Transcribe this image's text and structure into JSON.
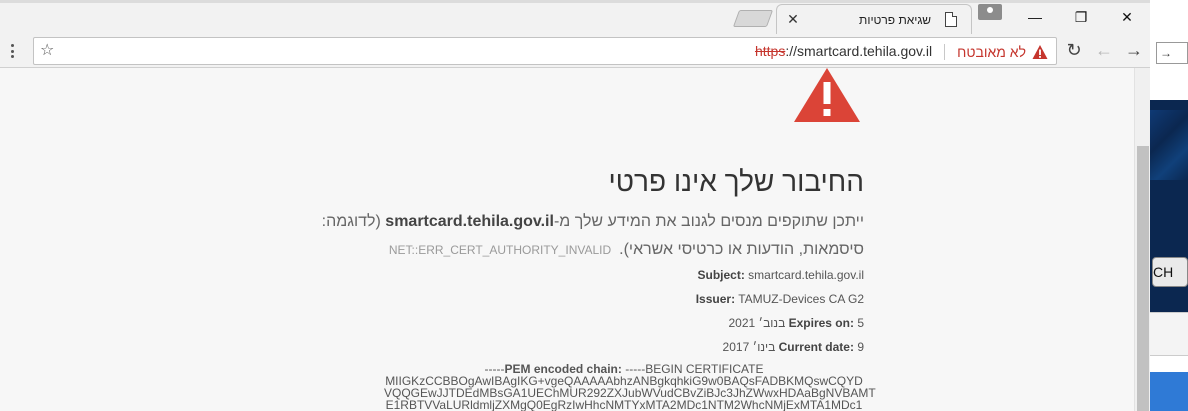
{
  "background_app": {
    "input_text": "→",
    "button_text": "CH"
  },
  "browser": {
    "tab": {
      "title": "שגיאת פרטיות",
      "close_glyph": "✕"
    },
    "window_controls": {
      "minimize": "—",
      "maximize": "❐",
      "close": "✕"
    },
    "address_bar": {
      "security_label": "לא מאובטח",
      "url_scheme": "https",
      "url_rest": "://smartcard.tehila.gov.il"
    }
  },
  "page": {
    "heading": "החיבור שלך אינו פרטי",
    "description_part1": "ייתכן שתוקפים מנסים לגנוב את המידע שלך מ-",
    "description_host": "smartcard.tehila.gov.il",
    "description_part2": " (לדוגמה: סיסמאות, הודעות או כרטיסי אשראי).",
    "error_code": "NET::ERR_CERT_AUTHORITY_INVALID",
    "subject_label": "Subject:",
    "subject_value": "smartcard.tehila.gov.il",
    "issuer_label": "Issuer:",
    "issuer_value": "TAMUZ-Devices CA G2",
    "expires_label": "Expires on:",
    "expires_value": "5 בנוב׳ 2021",
    "current_label": "Current date:",
    "current_value": "9 בינו׳ 2017",
    "pem_label": "PEM encoded chain:",
    "pem_prefix": "-----",
    "pem_begin": " -----BEGIN CERTIFICATE",
    "pem_lines": [
      "MIIGKzCCBBOgAwIBAgIKG+vgeQAAAAAbhzANBgkqhkiG9w0BAQsFADBKMQswCQYD",
      "VQQGEwJJTDEdMBsGA1UEChMUR292ZXJubWVudCBvZiBJc3JhZWwxHDAaBgNVBAMT",
      "E1RBTVVaLURldmljZXMgQ0EgRzIwHhcNMTYxMTA2MDc1NTM2WhcNMjExMTA1MDc1"
    ]
  }
}
